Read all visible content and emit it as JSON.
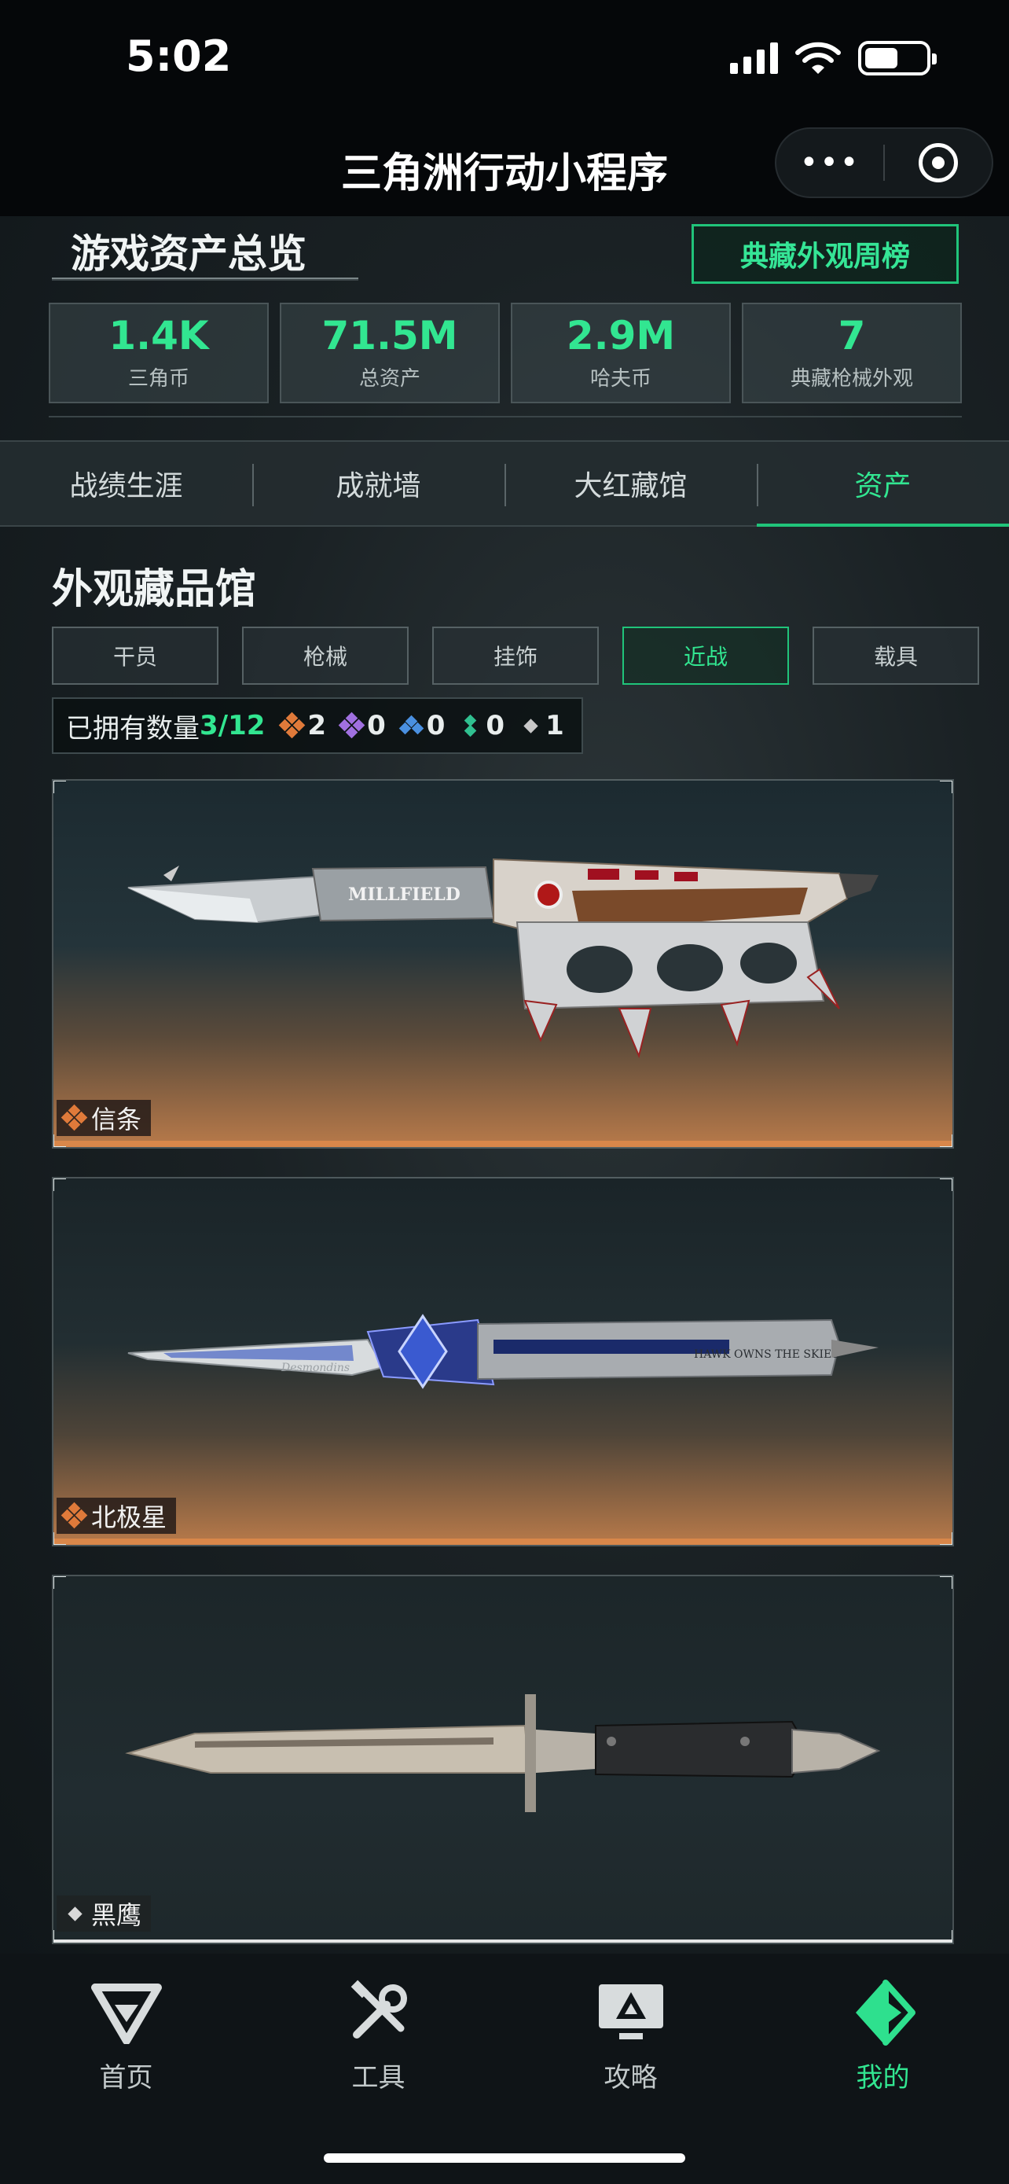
{
  "status_bar": {
    "time": "5:02"
  },
  "title_bar": {
    "title": "三角洲行动小程序",
    "more_icon": "•••"
  },
  "overview": {
    "title": "游戏资产总览",
    "weekly_button": "典藏外观周榜",
    "stats": [
      {
        "value": "1.4K",
        "label": "三角币"
      },
      {
        "value": "71.5M",
        "label": "总资产"
      },
      {
        "value": "2.9M",
        "label": "哈夫币"
      },
      {
        "value": "7",
        "label": "典藏枪械外观"
      }
    ]
  },
  "tabs": [
    {
      "label": "战绩生涯",
      "active": false
    },
    {
      "label": "成就墙",
      "active": false
    },
    {
      "label": "大红藏馆",
      "active": false
    },
    {
      "label": "资产",
      "active": true
    }
  ],
  "gallery": {
    "title": "外观藏品馆",
    "filters": [
      {
        "label": "干员",
        "active": false
      },
      {
        "label": "枪械",
        "active": false
      },
      {
        "label": "挂饰",
        "active": false
      },
      {
        "label": "近战",
        "active": true
      },
      {
        "label": "载具",
        "active": false
      }
    ],
    "owned_label": "已拥有数量",
    "owned_count": "3/12",
    "rarity_counts": [
      {
        "icon": "orange-gem-icon",
        "color": "#e07a3a",
        "count": "2"
      },
      {
        "icon": "purple-gem-icon",
        "color": "#a070e0",
        "count": "0"
      },
      {
        "icon": "blue-gem-icon",
        "color": "#4a90e0",
        "count": "0"
      },
      {
        "icon": "green-gem-icon",
        "color": "#30c090",
        "count": "0"
      },
      {
        "icon": "white-gem-icon",
        "color": "#c8c8c8",
        "count": "1"
      }
    ],
    "items": [
      {
        "name": "信条",
        "rarity": "orange",
        "engraving": "MILLFIELD"
      },
      {
        "name": "北极星",
        "rarity": "orange",
        "engraving": "HAWK OWNS THE SKIES",
        "engraving2": "Desmondins"
      },
      {
        "name": "黑鹰",
        "rarity": "white"
      }
    ]
  },
  "bottom_nav": [
    {
      "label": "首页",
      "icon": "delta-logo-icon",
      "active": false
    },
    {
      "label": "工具",
      "icon": "tools-icon",
      "active": false
    },
    {
      "label": "攻略",
      "icon": "guide-monitor-icon",
      "active": false
    },
    {
      "label": "我的",
      "icon": "profile-logo-icon",
      "active": true
    }
  ],
  "colors": {
    "accent": "#32e691",
    "orange_rarity": "#e07a3a",
    "background": "#0d1417"
  }
}
